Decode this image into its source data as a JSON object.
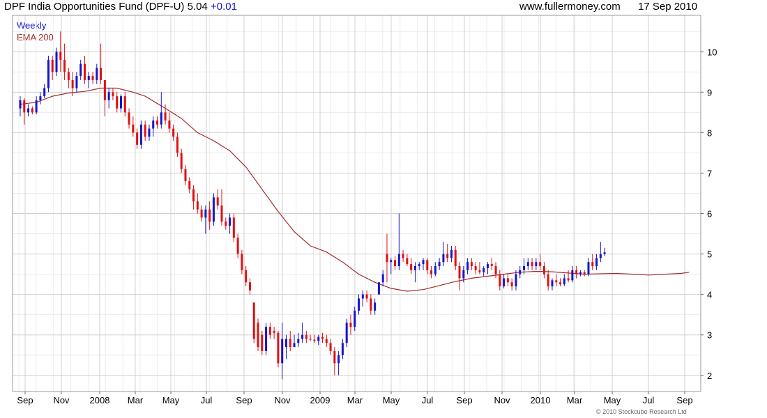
{
  "header": {
    "title": "DPF India Opportunities Fund (DPF-U) 5.04",
    "change": "+0.01",
    "site": "www.fullermoney.com",
    "date": "17 Sep 2010"
  },
  "copyright": "© 2010 Stockcube Research Ltd",
  "colors": {
    "up": "#1515cc",
    "down": "#e01010",
    "ema": "#a52a2a",
    "grid": "#d0d0d0"
  },
  "chart_data": {
    "type": "candlestick",
    "title": "DPF India Opportunities Fund (DPF-U) 5.04 +0.01",
    "frequency_label": "Weekly",
    "series": [
      {
        "name": "Weekly"
      },
      {
        "name": "EMA 200"
      }
    ],
    "x_ticks": [
      "Sep",
      "Nov",
      "2008",
      "Mar",
      "May",
      "Jul",
      "Sep",
      "Nov",
      "2009",
      "Mar",
      "May",
      "Jul",
      "Sep",
      "Nov",
      "2010",
      "Mar",
      "May",
      "Jul",
      "Sep"
    ],
    "y_ticks": [
      2,
      3,
      4,
      5,
      6,
      7,
      8,
      9,
      10
    ],
    "ylim": [
      1.6,
      10.9
    ],
    "grid": true,
    "candles": [
      {
        "o": 8.6,
        "h": 8.9,
        "l": 8.4,
        "c": 8.8
      },
      {
        "o": 8.8,
        "h": 8.85,
        "l": 8.2,
        "c": 8.5
      },
      {
        "o": 8.5,
        "h": 8.7,
        "l": 8.4,
        "c": 8.6
      },
      {
        "o": 8.6,
        "h": 8.65,
        "l": 8.45,
        "c": 8.5
      },
      {
        "o": 8.5,
        "h": 8.9,
        "l": 8.45,
        "c": 8.8
      },
      {
        "o": 8.8,
        "h": 9.0,
        "l": 8.7,
        "c": 8.9
      },
      {
        "o": 8.9,
        "h": 9.2,
        "l": 8.85,
        "c": 9.1
      },
      {
        "o": 9.1,
        "h": 9.9,
        "l": 9.0,
        "c": 9.8
      },
      {
        "o": 9.8,
        "h": 9.9,
        "l": 9.3,
        "c": 9.5
      },
      {
        "o": 9.5,
        "h": 10.1,
        "l": 9.4,
        "c": 10.0
      },
      {
        "o": 10.0,
        "h": 10.5,
        "l": 9.5,
        "c": 9.8
      },
      {
        "o": 9.8,
        "h": 10.2,
        "l": 9.3,
        "c": 9.5
      },
      {
        "o": 9.5,
        "h": 9.6,
        "l": 9.1,
        "c": 9.3
      },
      {
        "o": 9.3,
        "h": 9.5,
        "l": 8.9,
        "c": 9.1
      },
      {
        "o": 9.1,
        "h": 9.5,
        "l": 9.0,
        "c": 9.4
      },
      {
        "o": 9.4,
        "h": 9.8,
        "l": 9.3,
        "c": 9.7
      },
      {
        "o": 9.7,
        "h": 9.9,
        "l": 9.2,
        "c": 9.3
      },
      {
        "o": 9.3,
        "h": 9.5,
        "l": 9.1,
        "c": 9.4
      },
      {
        "o": 9.4,
        "h": 9.5,
        "l": 9.2,
        "c": 9.3
      },
      {
        "o": 9.3,
        "h": 9.7,
        "l": 9.2,
        "c": 9.6
      },
      {
        "o": 9.6,
        "h": 10.2,
        "l": 9.2,
        "c": 9.3
      },
      {
        "o": 9.3,
        "h": 9.3,
        "l": 8.4,
        "c": 8.8
      },
      {
        "o": 8.8,
        "h": 9.1,
        "l": 8.6,
        "c": 9.0
      },
      {
        "o": 9.0,
        "h": 9.1,
        "l": 8.8,
        "c": 8.9
      },
      {
        "o": 8.9,
        "h": 9.0,
        "l": 8.5,
        "c": 8.6
      },
      {
        "o": 8.6,
        "h": 8.95,
        "l": 8.5,
        "c": 8.9
      },
      {
        "o": 8.9,
        "h": 9.0,
        "l": 8.4,
        "c": 8.5
      },
      {
        "o": 8.5,
        "h": 8.6,
        "l": 8.1,
        "c": 8.2
      },
      {
        "o": 8.2,
        "h": 8.4,
        "l": 7.9,
        "c": 8.0
      },
      {
        "o": 8.0,
        "h": 8.1,
        "l": 7.6,
        "c": 7.7
      },
      {
        "o": 7.7,
        "h": 8.3,
        "l": 7.6,
        "c": 8.2
      },
      {
        "o": 8.2,
        "h": 8.3,
        "l": 7.8,
        "c": 7.9
      },
      {
        "o": 7.9,
        "h": 8.2,
        "l": 7.8,
        "c": 8.1
      },
      {
        "o": 8.1,
        "h": 8.4,
        "l": 7.9,
        "c": 8.3
      },
      {
        "o": 8.3,
        "h": 8.4,
        "l": 8.1,
        "c": 8.2
      },
      {
        "o": 8.2,
        "h": 9.0,
        "l": 8.1,
        "c": 8.5
      },
      {
        "o": 8.5,
        "h": 8.7,
        "l": 8.2,
        "c": 8.3
      },
      {
        "o": 8.3,
        "h": 8.5,
        "l": 8.0,
        "c": 8.1
      },
      {
        "o": 8.1,
        "h": 8.2,
        "l": 7.8,
        "c": 7.9
      },
      {
        "o": 7.9,
        "h": 8.0,
        "l": 7.4,
        "c": 7.5
      },
      {
        "o": 7.5,
        "h": 7.6,
        "l": 7.0,
        "c": 7.1
      },
      {
        "o": 7.1,
        "h": 7.2,
        "l": 6.7,
        "c": 6.8
      },
      {
        "o": 6.8,
        "h": 6.9,
        "l": 6.5,
        "c": 6.6
      },
      {
        "o": 6.6,
        "h": 6.7,
        "l": 6.1,
        "c": 6.3
      },
      {
        "o": 6.3,
        "h": 6.5,
        "l": 6.0,
        "c": 6.1
      },
      {
        "o": 6.1,
        "h": 6.2,
        "l": 5.8,
        "c": 5.9
      },
      {
        "o": 5.9,
        "h": 6.2,
        "l": 5.5,
        "c": 6.1
      },
      {
        "o": 6.1,
        "h": 6.3,
        "l": 5.6,
        "c": 5.8
      },
      {
        "o": 5.8,
        "h": 6.5,
        "l": 5.7,
        "c": 6.4
      },
      {
        "o": 6.4,
        "h": 6.6,
        "l": 6.1,
        "c": 6.2
      },
      {
        "o": 6.2,
        "h": 6.6,
        "l": 5.7,
        "c": 5.8
      },
      {
        "o": 5.8,
        "h": 5.9,
        "l": 5.6,
        "c": 5.7
      },
      {
        "o": 5.7,
        "h": 6.0,
        "l": 5.5,
        "c": 5.9
      },
      {
        "o": 5.9,
        "h": 6.0,
        "l": 5.3,
        "c": 5.4
      },
      {
        "o": 5.4,
        "h": 5.5,
        "l": 4.9,
        "c": 5.0
      },
      {
        "o": 5.0,
        "h": 5.1,
        "l": 4.5,
        "c": 4.6
      },
      {
        "o": 4.6,
        "h": 4.7,
        "l": 4.2,
        "c": 4.3
      },
      {
        "o": 4.3,
        "h": 4.4,
        "l": 4.0,
        "c": 4.1
      },
      {
        "o": 3.8,
        "h": 3.8,
        "l": 2.8,
        "c": 2.9
      },
      {
        "o": 3.3,
        "h": 3.4,
        "l": 2.6,
        "c": 2.7
      },
      {
        "o": 3.0,
        "h": 3.1,
        "l": 2.5,
        "c": 2.6
      },
      {
        "o": 2.6,
        "h": 3.3,
        "l": 2.5,
        "c": 3.2
      },
      {
        "o": 3.2,
        "h": 3.3,
        "l": 2.9,
        "c": 3.0
      },
      {
        "o": 3.1,
        "h": 3.2,
        "l": 2.9,
        "c": 3.05
      },
      {
        "o": 3.05,
        "h": 3.1,
        "l": 2.2,
        "c": 2.3
      },
      {
        "o": 2.3,
        "h": 3.3,
        "l": 1.9,
        "c": 2.9
      },
      {
        "o": 2.7,
        "h": 3.0,
        "l": 2.4,
        "c": 2.9
      },
      {
        "o": 2.9,
        "h": 3.1,
        "l": 2.6,
        "c": 2.7
      },
      {
        "o": 2.7,
        "h": 3.0,
        "l": 2.7,
        "c": 2.8
      },
      {
        "o": 2.8,
        "h": 3.05,
        "l": 2.7,
        "c": 2.9
      },
      {
        "o": 2.9,
        "h": 3.3,
        "l": 2.8,
        "c": 3.0
      },
      {
        "o": 3.0,
        "h": 3.1,
        "l": 2.8,
        "c": 2.9
      },
      {
        "o": 2.9,
        "h": 3.0,
        "l": 2.85,
        "c": 2.88
      },
      {
        "o": 2.88,
        "h": 3.0,
        "l": 2.8,
        "c": 2.85
      },
      {
        "o": 2.85,
        "h": 3.0,
        "l": 2.75,
        "c": 2.95
      },
      {
        "o": 2.95,
        "h": 3.05,
        "l": 2.8,
        "c": 2.9
      },
      {
        "o": 2.9,
        "h": 3.0,
        "l": 2.7,
        "c": 2.8
      },
      {
        "o": 2.8,
        "h": 2.9,
        "l": 2.5,
        "c": 2.6
      },
      {
        "o": 2.6,
        "h": 2.7,
        "l": 2.0,
        "c": 2.3
      },
      {
        "o": 2.3,
        "h": 2.6,
        "l": 2.0,
        "c": 2.5
      },
      {
        "o": 2.5,
        "h": 2.9,
        "l": 2.4,
        "c": 2.8
      },
      {
        "o": 2.8,
        "h": 3.4,
        "l": 2.7,
        "c": 3.3
      },
      {
        "o": 3.3,
        "h": 3.5,
        "l": 3.0,
        "c": 3.2
      },
      {
        "o": 3.2,
        "h": 3.7,
        "l": 3.1,
        "c": 3.6
      },
      {
        "o": 3.6,
        "h": 4.0,
        "l": 3.5,
        "c": 3.9
      },
      {
        "o": 3.9,
        "h": 4.1,
        "l": 3.7,
        "c": 4.0
      },
      {
        "o": 4.0,
        "h": 4.1,
        "l": 3.8,
        "c": 3.9
      },
      {
        "o": 3.9,
        "h": 4.0,
        "l": 3.5,
        "c": 3.6
      },
      {
        "o": 3.6,
        "h": 3.9,
        "l": 3.5,
        "c": 3.8
      },
      {
        "o": 4.0,
        "h": 4.3,
        "l": 4.0,
        "c": 4.3
      },
      {
        "o": 4.3,
        "h": 4.6,
        "l": 4.2,
        "c": 4.5
      },
      {
        "o": 5.0,
        "h": 5.5,
        "l": 4.3,
        "c": 4.8
      },
      {
        "o": 4.8,
        "h": 4.9,
        "l": 4.5,
        "c": 4.85
      },
      {
        "o": 4.85,
        "h": 4.95,
        "l": 4.6,
        "c": 4.7
      },
      {
        "o": 4.7,
        "h": 6.0,
        "l": 4.6,
        "c": 5.0
      },
      {
        "o": 5.0,
        "h": 5.1,
        "l": 4.8,
        "c": 4.9
      },
      {
        "o": 4.9,
        "h": 5.0,
        "l": 4.7,
        "c": 4.75
      },
      {
        "o": 4.75,
        "h": 4.9,
        "l": 4.5,
        "c": 4.6
      },
      {
        "o": 4.6,
        "h": 4.8,
        "l": 4.3,
        "c": 4.7
      },
      {
        "o": 4.7,
        "h": 4.8,
        "l": 4.6,
        "c": 4.75
      },
      {
        "o": 4.75,
        "h": 4.9,
        "l": 4.6,
        "c": 4.85
      },
      {
        "o": 4.85,
        "h": 4.9,
        "l": 4.5,
        "c": 4.6
      },
      {
        "o": 4.6,
        "h": 4.7,
        "l": 4.4,
        "c": 4.5
      },
      {
        "o": 4.5,
        "h": 4.8,
        "l": 4.45,
        "c": 4.7
      },
      {
        "o": 4.7,
        "h": 4.9,
        "l": 4.6,
        "c": 4.8
      },
      {
        "o": 4.8,
        "h": 5.3,
        "l": 4.7,
        "c": 5.0
      },
      {
        "o": 5.0,
        "h": 5.25,
        "l": 4.8,
        "c": 4.9
      },
      {
        "o": 4.9,
        "h": 5.2,
        "l": 4.8,
        "c": 5.1
      },
      {
        "o": 5.1,
        "h": 5.2,
        "l": 4.6,
        "c": 4.7
      },
      {
        "o": 4.7,
        "h": 4.8,
        "l": 4.1,
        "c": 4.4
      },
      {
        "o": 4.4,
        "h": 4.7,
        "l": 4.3,
        "c": 4.6
      },
      {
        "o": 4.6,
        "h": 4.9,
        "l": 4.5,
        "c": 4.8
      },
      {
        "o": 4.8,
        "h": 4.9,
        "l": 4.6,
        "c": 4.7
      },
      {
        "o": 4.7,
        "h": 4.8,
        "l": 4.5,
        "c": 4.6
      },
      {
        "o": 4.6,
        "h": 4.8,
        "l": 4.5,
        "c": 4.55
      },
      {
        "o": 4.55,
        "h": 4.7,
        "l": 4.45,
        "c": 4.65
      },
      {
        "o": 4.65,
        "h": 4.8,
        "l": 4.5,
        "c": 4.75
      },
      {
        "o": 4.75,
        "h": 4.9,
        "l": 4.6,
        "c": 4.7
      },
      {
        "o": 4.7,
        "h": 4.8,
        "l": 4.4,
        "c": 4.5
      },
      {
        "o": 4.5,
        "h": 4.6,
        "l": 4.1,
        "c": 4.2
      },
      {
        "o": 4.2,
        "h": 4.5,
        "l": 4.15,
        "c": 4.4
      },
      {
        "o": 4.4,
        "h": 4.5,
        "l": 4.2,
        "c": 4.3
      },
      {
        "o": 4.3,
        "h": 4.4,
        "l": 4.1,
        "c": 4.2
      },
      {
        "o": 4.2,
        "h": 4.6,
        "l": 4.1,
        "c": 4.5
      },
      {
        "o": 4.5,
        "h": 4.7,
        "l": 4.4,
        "c": 4.6
      },
      {
        "o": 4.6,
        "h": 4.9,
        "l": 4.5,
        "c": 4.7
      },
      {
        "o": 4.7,
        "h": 4.9,
        "l": 4.6,
        "c": 4.8
      },
      {
        "o": 4.8,
        "h": 4.9,
        "l": 4.6,
        "c": 4.7
      },
      {
        "o": 4.7,
        "h": 4.9,
        "l": 4.6,
        "c": 4.8
      },
      {
        "o": 4.8,
        "h": 5.0,
        "l": 4.6,
        "c": 4.7
      },
      {
        "o": 4.7,
        "h": 4.8,
        "l": 4.4,
        "c": 4.5
      },
      {
        "o": 4.5,
        "h": 4.6,
        "l": 4.1,
        "c": 4.2
      },
      {
        "o": 4.2,
        "h": 4.4,
        "l": 4.1,
        "c": 4.35
      },
      {
        "o": 4.35,
        "h": 4.5,
        "l": 4.2,
        "c": 4.3
      },
      {
        "o": 4.3,
        "h": 4.4,
        "l": 4.2,
        "c": 4.25
      },
      {
        "o": 4.25,
        "h": 4.5,
        "l": 4.2,
        "c": 4.4
      },
      {
        "o": 4.4,
        "h": 4.6,
        "l": 4.3,
        "c": 4.35
      },
      {
        "o": 4.35,
        "h": 4.7,
        "l": 4.3,
        "c": 4.6
      },
      {
        "o": 4.6,
        "h": 4.7,
        "l": 4.4,
        "c": 4.5
      },
      {
        "o": 4.5,
        "h": 4.6,
        "l": 4.45,
        "c": 4.55
      },
      {
        "o": 4.55,
        "h": 4.6,
        "l": 4.45,
        "c": 4.5
      },
      {
        "o": 4.5,
        "h": 4.9,
        "l": 4.45,
        "c": 4.8
      },
      {
        "o": 4.8,
        "h": 5.0,
        "l": 4.6,
        "c": 4.7
      },
      {
        "o": 4.7,
        "h": 5.0,
        "l": 4.6,
        "c": 4.9
      },
      {
        "o": 4.9,
        "h": 5.3,
        "l": 4.8,
        "c": 5.0
      },
      {
        "o": 5.0,
        "h": 5.15,
        "l": 4.95,
        "c": 5.04
      }
    ],
    "ema200": [
      [
        0,
        8.7
      ],
      [
        4,
        8.75
      ],
      [
        8,
        8.9
      ],
      [
        12,
        8.98
      ],
      [
        16,
        9.02
      ],
      [
        20,
        9.1
      ],
      [
        24,
        9.1
      ],
      [
        28,
        9.0
      ],
      [
        31,
        8.9
      ],
      [
        36,
        8.6
      ],
      [
        40,
        8.35
      ],
      [
        44,
        8.0
      ],
      [
        48,
        7.8
      ],
      [
        52,
        7.55
      ],
      [
        56,
        7.15
      ],
      [
        60,
        6.6
      ],
      [
        64,
        6.05
      ],
      [
        68,
        5.55
      ],
      [
        72,
        5.2
      ],
      [
        76,
        5.05
      ],
      [
        80,
        4.8
      ],
      [
        84,
        4.5
      ],
      [
        88,
        4.3
      ],
      [
        92,
        4.15
      ],
      [
        96,
        4.08
      ],
      [
        100,
        4.12
      ],
      [
        104,
        4.22
      ],
      [
        108,
        4.32
      ],
      [
        112,
        4.4
      ],
      [
        116,
        4.45
      ],
      [
        120,
        4.5
      ],
      [
        124,
        4.55
      ],
      [
        128,
        4.57
      ],
      [
        132,
        4.56
      ],
      [
        136,
        4.53
      ],
      [
        140,
        4.5
      ],
      [
        144,
        4.51
      ],
      [
        148,
        4.52
      ],
      [
        152,
        4.5
      ],
      [
        156,
        4.48
      ],
      [
        160,
        4.5
      ],
      [
        164,
        4.52
      ],
      [
        166,
        4.55
      ]
    ]
  }
}
